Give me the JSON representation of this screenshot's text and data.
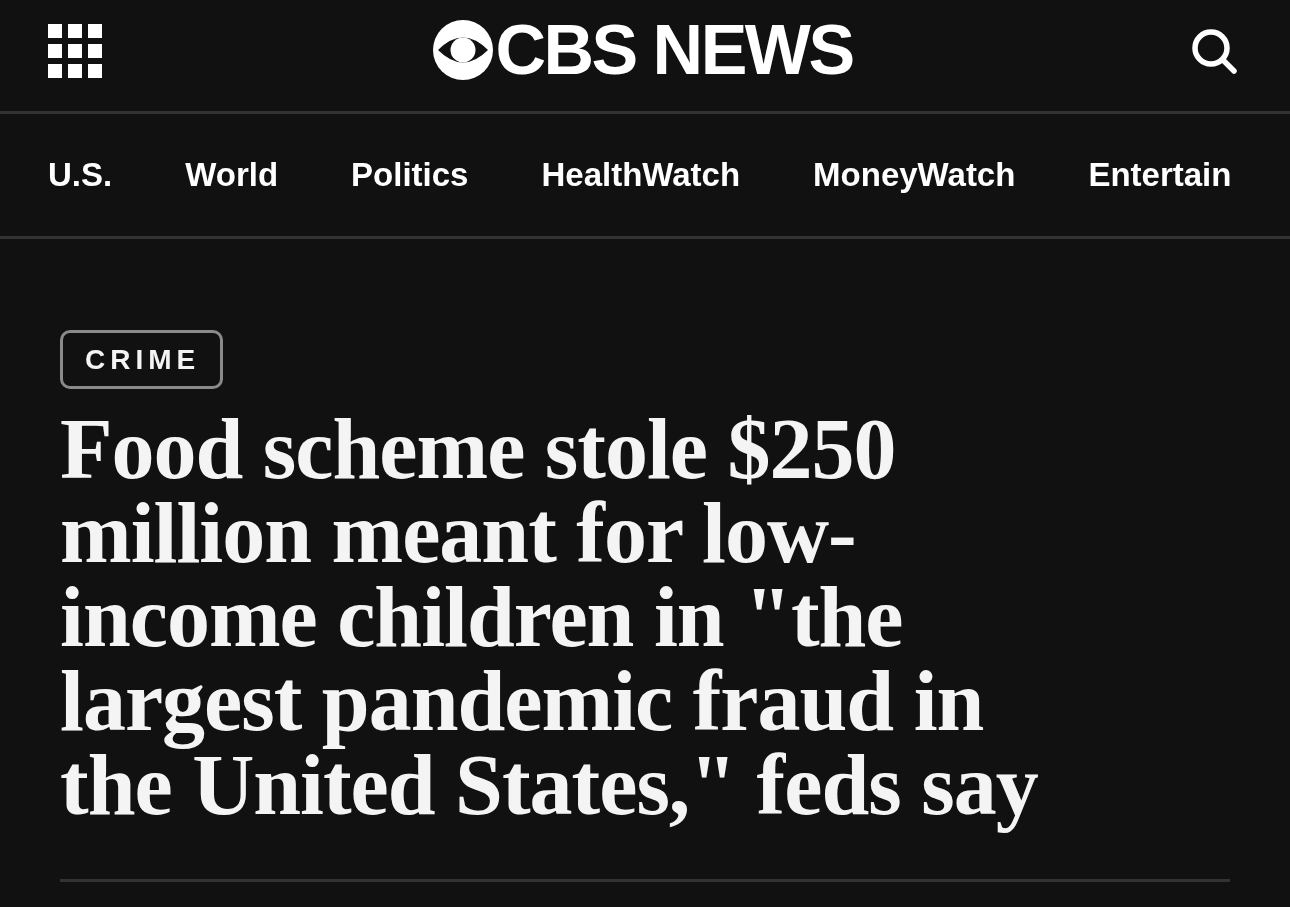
{
  "header": {
    "logo": "CBS NEWS"
  },
  "nav": {
    "items": [
      {
        "label": "U.S."
      },
      {
        "label": "World"
      },
      {
        "label": "Politics"
      },
      {
        "label": "HealthWatch"
      },
      {
        "label": "MoneyWatch"
      },
      {
        "label": "Entertain"
      }
    ]
  },
  "article": {
    "category": "CRIME",
    "headline": "Food scheme stole $250 million meant for low-income children in \"the largest pandemic fraud in the United States,\" feds say"
  }
}
